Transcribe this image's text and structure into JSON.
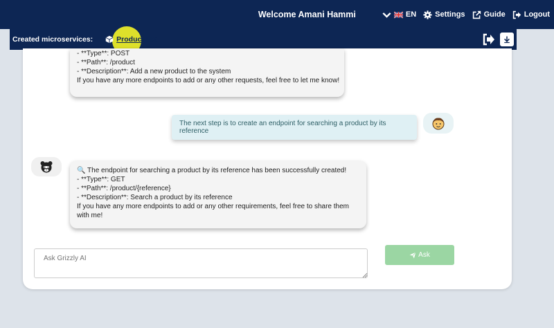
{
  "navbar": {
    "welcome": "Welcome Amani Hammi",
    "language": "EN",
    "settings": "Settings",
    "guide": "Guide",
    "logout": "Logout"
  },
  "microservices": {
    "label": "Created microservices:",
    "items": [
      {
        "name": "Product MS"
      }
    ]
  },
  "chat": {
    "prev_bot_message": {
      "lines": [
        "- **Type**: POST",
        "- **Path**: /product",
        "- **Description**: Add a new product to the system",
        "If you have any more endpoints to add or any other requests, feel free to let me know!"
      ]
    },
    "user_message": "The next step is to create an endpoint for searching a product by its reference",
    "bot_message": {
      "lines": [
        "🔍 The endpoint for searching a product by its reference has been successfully created!",
        "- **Type**: GET",
        "- **Path**: /product/{reference}",
        "- **Description**: Search a product by its reference",
        "If you have any more endpoints to add or any other requirements, feel free to share them with me!"
      ]
    }
  },
  "input": {
    "placeholder": "Ask Grizzly AI",
    "value": ""
  },
  "ask_button": "Ask",
  "colors": {
    "navbar": "#0d2654",
    "highlight": "#f0f028",
    "ask_button": "#9bd6a3",
    "user_bubble": "#dff0f4"
  }
}
